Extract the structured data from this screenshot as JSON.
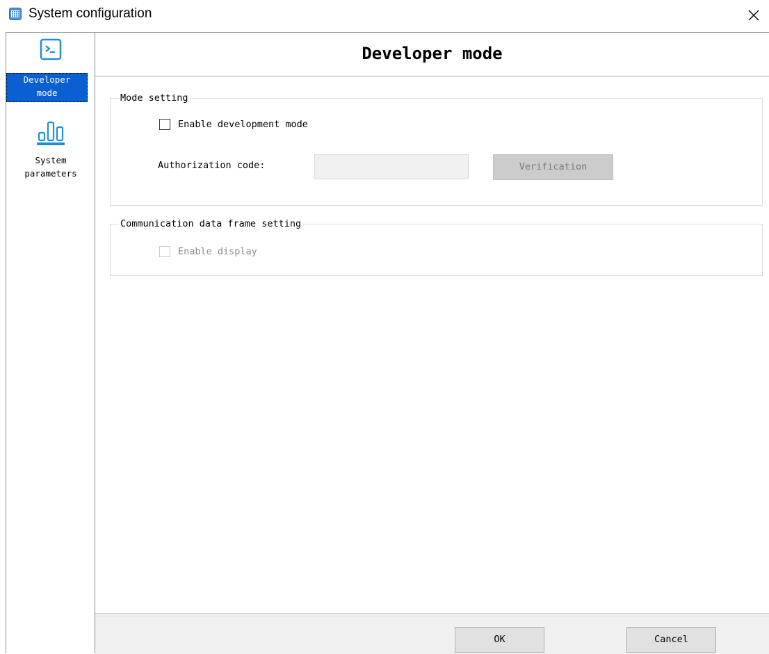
{
  "window": {
    "title": "System configuration"
  },
  "sidebar": {
    "items": [
      {
        "label": "Developer\nmode",
        "icon": "terminal-icon",
        "selected": true
      },
      {
        "label": "System\nparameters",
        "icon": "bar-chart-icon",
        "selected": false
      }
    ]
  },
  "header": {
    "title": "Developer mode"
  },
  "mode_setting": {
    "legend": "Mode setting",
    "enable_dev_label": "Enable development mode",
    "enable_dev_checked": false,
    "auth_label": "Authorization code:",
    "auth_value": "",
    "verify_label": "Verification"
  },
  "comm_setting": {
    "legend": "Communication data frame setting",
    "enable_display_label": "Enable display",
    "enable_display_checked": false
  },
  "footer": {
    "ok_label": "OK",
    "cancel_label": "Cancel"
  },
  "colors": {
    "selection": "#0a5fd3",
    "icon_blue": "#1e8fd6",
    "disabled_button": "#cccccc"
  }
}
